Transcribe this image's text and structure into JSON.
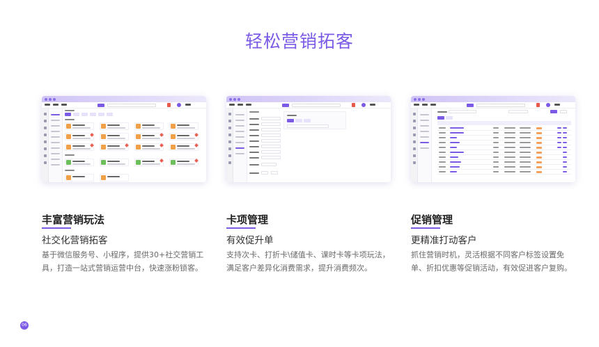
{
  "page": {
    "title": "轻松营销拓客",
    "page_number": "06"
  },
  "features": [
    {
      "title": "丰富营销玩法",
      "subtitle": "社交化营销拓客",
      "description": "基于微信服务号、小程序，提供30+社交营销工具，打造一站式营销运营中台，快速涨粉锁客。"
    },
    {
      "title": "卡项管理",
      "subtitle": "有效促升单",
      "description": "支持次卡、打折卡\\储值卡、课时卡等卡项玩法，满足客户差异化消费需求，提升消费频次。"
    },
    {
      "title": "促销管理",
      "subtitle": "更精准打动客户",
      "description": "抓住营销时机，灵活根据不同客户标签设置免单、折扣优惠等促销活动，有效促进客户复购。"
    }
  ],
  "colors": {
    "accent": "#7b5ae6",
    "heading": "#222222",
    "body_text": "#6a6a6a",
    "tag_orange": "#f3a05a",
    "badge_red": "#e8604f"
  },
  "icons": [
    "window-dot-icon",
    "avatar-icon",
    "marketing-tool-icon"
  ]
}
